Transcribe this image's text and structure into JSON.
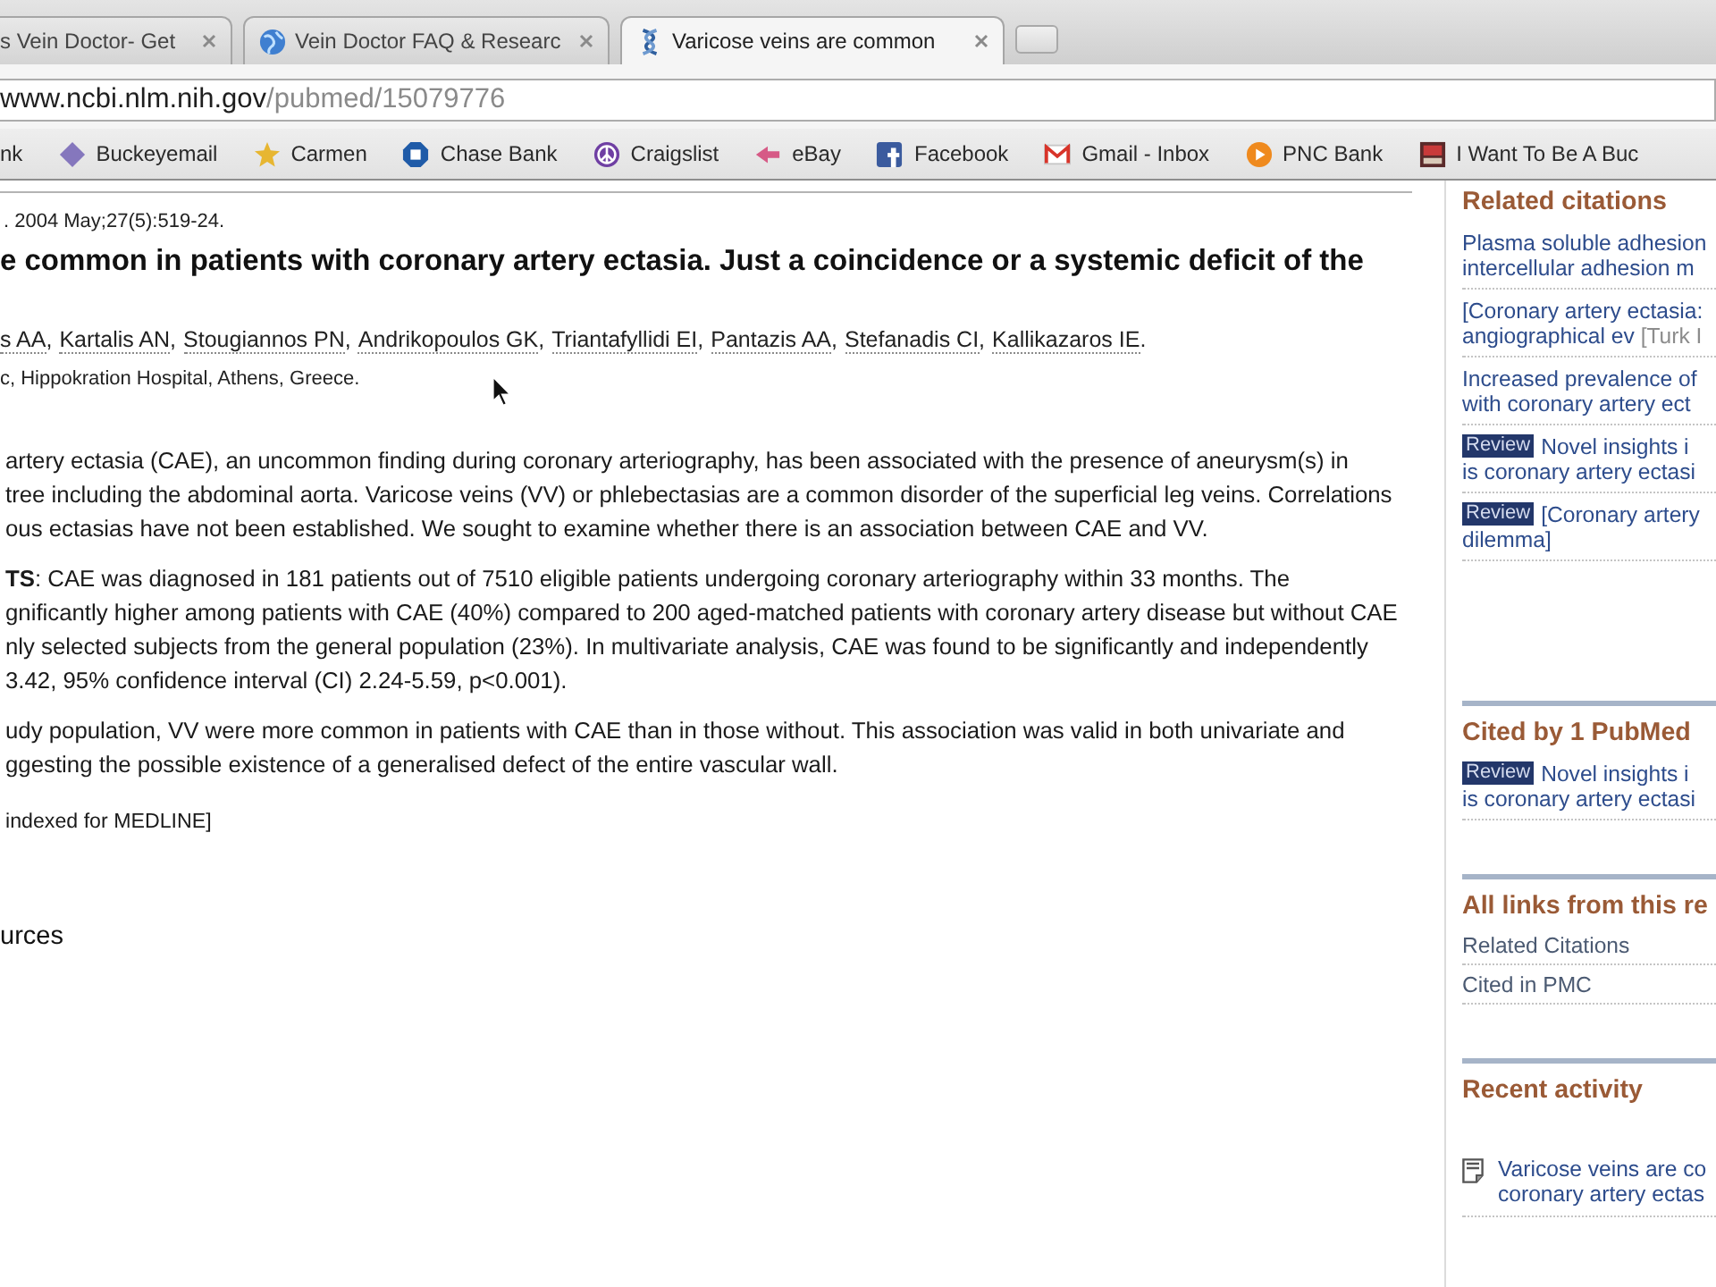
{
  "tabs": [
    {
      "title": "s Vein Doctor- Get",
      "selected": false
    },
    {
      "title": "Vein Doctor FAQ & Researc",
      "selected": false
    },
    {
      "title": "Varicose veins are common",
      "selected": true
    }
  ],
  "address_bar": {
    "host": "www.ncbi.nlm.nih.gov",
    "path": "/pubmed/15079776"
  },
  "bookmarks": [
    {
      "label": "nk"
    },
    {
      "label": "Buckeyemail"
    },
    {
      "label": "Carmen"
    },
    {
      "label": "Chase Bank"
    },
    {
      "label": "Craigslist"
    },
    {
      "label": "eBay"
    },
    {
      "label": "Facebook"
    },
    {
      "label": "Gmail - Inbox"
    },
    {
      "label": "PNC Bank"
    },
    {
      "label": "I Want To Be A Buc"
    }
  ],
  "article": {
    "citation": ". 2004 May;27(5):519-24.",
    "title": "e common in patients with coronary artery ectasia. Just a coincidence or a systemic deficit of the",
    "authors": [
      {
        "name": "s AA",
        "punct": ","
      },
      {
        "name": "Kartalis AN",
        "punct": ","
      },
      {
        "name": "Stougiannos PN",
        "punct": ","
      },
      {
        "name": "Andrikopoulos GK",
        "punct": ","
      },
      {
        "name": "Triantafyllidi EI",
        "punct": ","
      },
      {
        "name": "Pantazis AA",
        "punct": ","
      },
      {
        "name": "Stefanadis CI",
        "punct": ","
      },
      {
        "name": "Kallikazaros IE",
        "punct": "."
      }
    ],
    "affiliation": "c, Hippokration Hospital, Athens, Greece.",
    "abstract": [
      {
        "lines": [
          "artery ectasia (CAE), an uncommon finding during coronary arteriography, has been associated with the presence of aneurysm(s) in",
          "tree including the abdominal aorta. Varicose veins (VV) or phlebectasias are a common disorder of the superficial leg veins. Correlations",
          "ous ectasias have not been established. We sought to examine whether there is an association between CAE and VV."
        ]
      },
      {
        "lines": [
          "**TS**: CAE was diagnosed in 181 patients out of 7510 eligible patients undergoing coronary arteriography within 33 months. The",
          "gnificantly higher among patients with CAE (40%) compared to 200 aged-matched patients with coronary artery disease but without CAE",
          "nly selected subjects from the general population (23%). In multivariate analysis, CAE was found to be significantly and independently",
          "3.42, 95% confidence interval (CI) 2.24-5.59, p<0.001)."
        ]
      },
      {
        "lines": [
          "udy population, VV were more common in patients with CAE than in those without. This association was valid in both univariate and",
          "ggesting the possible existence of a generalised defect of the entire vascular wall."
        ]
      }
    ],
    "indexing": "indexed for MEDLINE]",
    "sources": "urces"
  },
  "sidebar": {
    "sections": [
      {
        "kind": "citations",
        "heading": "Related citations",
        "items": [
          {
            "lines": [
              "Plasma soluble adhesion",
              "intercellular adhesion m"
            ]
          },
          {
            "lines": [
              "[Coronary artery ectasia:",
              "angiographical ev"
            ],
            "journal": "[Turk I"
          },
          {
            "lines": [
              "Increased prevalence of",
              "with coronary artery ect"
            ]
          },
          {
            "badge": "Review",
            "lines": [
              "Novel insights i",
              "is coronary artery ectasi"
            ]
          },
          {
            "badge": "Review",
            "lines": [
              "[Coronary artery",
              "dilemma]"
            ]
          }
        ]
      },
      {
        "kind": "citations",
        "heading": "Cited by 1 PubMed",
        "items": [
          {
            "badge": "Review",
            "lines": [
              "Novel insights i",
              "is coronary artery ectasi"
            ]
          }
        ]
      },
      {
        "kind": "links",
        "heading": "All links from this re",
        "items": [
          {
            "lines": [
              "Related Citations"
            ]
          },
          {
            "lines": [
              "Cited in PMC"
            ]
          }
        ]
      },
      {
        "kind": "recent",
        "heading": "Recent activity",
        "items": [
          {
            "lines": [
              "Varicose veins are co",
              "coronary artery ectas"
            ]
          }
        ]
      }
    ]
  }
}
